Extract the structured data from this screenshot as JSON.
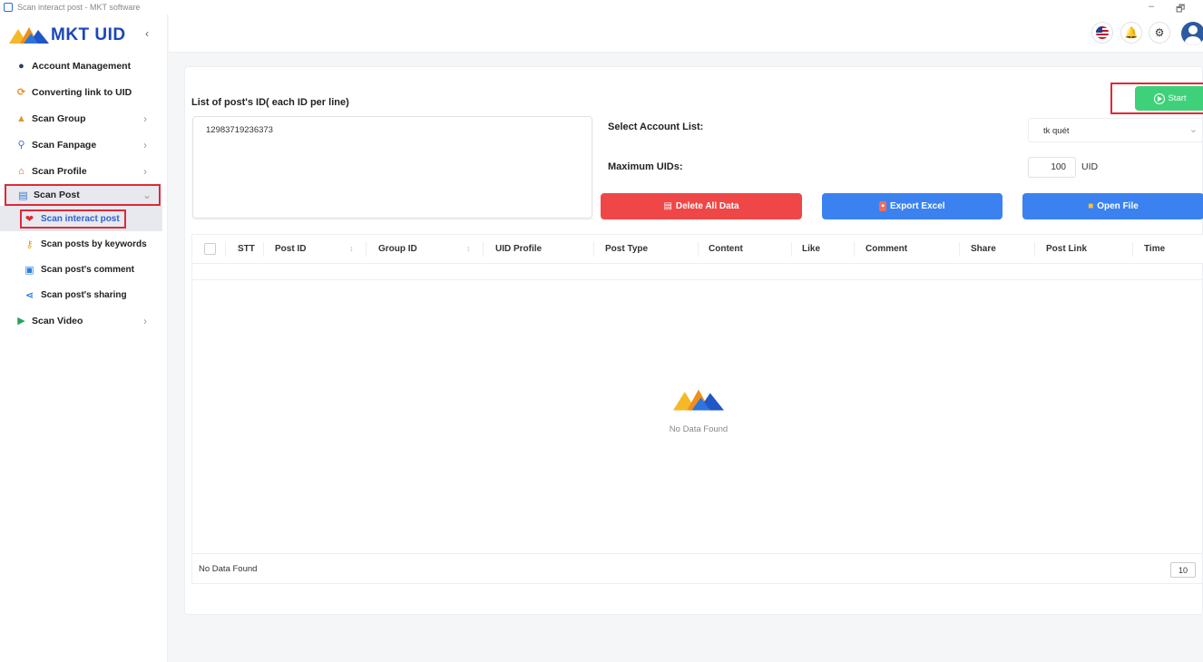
{
  "window": {
    "title": "Scan interact post - MKT software",
    "min": "–",
    "max": "🗗"
  },
  "brand": {
    "name": "MKT UID"
  },
  "sidebar": {
    "collapse": "‹",
    "items": [
      {
        "label": "Account Management",
        "icon": "user-circle-icon",
        "glyph": "●",
        "color": "#2a3e66",
        "chevron": ""
      },
      {
        "label": "Converting link to UID",
        "icon": "refresh-icon",
        "glyph": "⟳",
        "color": "#e98a1e",
        "chevron": ""
      },
      {
        "label": "Scan Group",
        "icon": "group-icon",
        "glyph": "👥",
        "color": "#d99a2a",
        "chevron": "›"
      },
      {
        "label": "Scan Fanpage",
        "icon": "search-icon",
        "glyph": "🔍",
        "color": "#3a75d0",
        "chevron": "›"
      },
      {
        "label": "Scan Profile",
        "icon": "profile-icon",
        "glyph": "🏠",
        "color": "#d2591d",
        "chevron": "›"
      },
      {
        "label": "Scan Post",
        "icon": "post-icon",
        "glyph": "▤",
        "color": "#3a75d0",
        "chevron": "⌄"
      }
    ],
    "sub_items": [
      {
        "label": "Scan interact post",
        "icon": "heart-icon",
        "glyph": "❤",
        "color": "#e02838"
      },
      {
        "label": "Scan posts by keywords",
        "icon": "key-icon",
        "glyph": "⚲",
        "color": "#e8a21a"
      },
      {
        "label": "Scan post's comment",
        "icon": "comment-icon",
        "glyph": "▣",
        "color": "#2a7de1"
      },
      {
        "label": "Scan post's sharing",
        "icon": "share-icon",
        "glyph": "⋖",
        "color": "#2a7de1"
      }
    ],
    "last_item": {
      "label": "Scan Video",
      "icon": "video-icon",
      "glyph": "▶",
      "color": "#22a55a",
      "chevron": "›"
    }
  },
  "topbar": {
    "flag": "🇺🇸",
    "bell": "🔔",
    "gear": "⚙"
  },
  "form": {
    "post_ids_label": "List of post's ID( each ID per line)",
    "post_ids_value": "12983719236373",
    "account_list_label": "Select Account List:",
    "account_list_value": "tk quét",
    "account_list_arrow": "⌄",
    "max_uids_label": "Maximum UIDs:",
    "max_uids_value": "100",
    "max_uids_unit": "UID",
    "start_label": "Start"
  },
  "actions": {
    "delete_label": "Delete All Data",
    "delete_color": "#ef4747",
    "export_label": "Export Excel",
    "export_color": "#3b82f0",
    "open_label": "Open File",
    "open_color": "#3b82f0"
  },
  "table": {
    "columns": [
      "STT",
      "Post ID",
      "Group ID",
      "UID Profile",
      "Post Type",
      "Content",
      "Like",
      "Comment",
      "Share",
      "Post Link",
      "Time"
    ],
    "sort_glyph": "↕",
    "empty_text": "No Data Found",
    "footer_text": "No Data Found",
    "page_size": "10"
  }
}
